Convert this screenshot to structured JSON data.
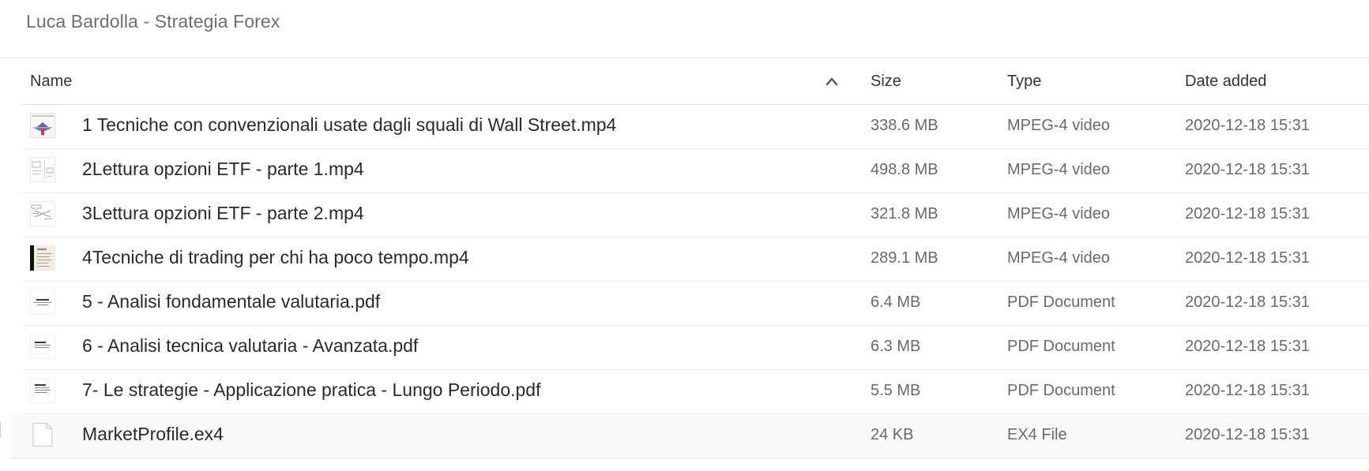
{
  "breadcrumb": "Luca Bardolla - Strategia Forex",
  "columns": {
    "name": "Name",
    "size": "Size",
    "type": "Type",
    "date": "Date added"
  },
  "files": [
    {
      "name": "1 Tecniche con convenzionali usate dagli squali di Wall Street.mp4",
      "size": "338.6 MB",
      "type": "MPEG-4 video",
      "date": "2020-12-18 15:31",
      "thumb": "video-thumb-chart"
    },
    {
      "name": "2Lettura opzioni ETF - parte 1.mp4",
      "size": "498.8 MB",
      "type": "MPEG-4 video",
      "date": "2020-12-18 15:31",
      "thumb": "video-thumb-doc"
    },
    {
      "name": "3Lettura opzioni ETF - parte 2.mp4",
      "size": "321.8 MB",
      "type": "MPEG-4 video",
      "date": "2020-12-18 15:31",
      "thumb": "video-thumb-diagram"
    },
    {
      "name": "4Tecniche di trading per chi ha poco tempo.mp4",
      "size": "289.1 MB",
      "type": "MPEG-4 video",
      "date": "2020-12-18 15:31",
      "thumb": "video-thumb-slide"
    },
    {
      "name": "5 - Analisi fondamentale valutaria.pdf",
      "size": "6.4 MB",
      "type": "PDF Document",
      "date": "2020-12-18 15:31",
      "thumb": "pdf-thumb"
    },
    {
      "name": "6 - Analisi tecnica valutaria - Avanzata.pdf",
      "size": "6.3 MB",
      "type": "PDF Document",
      "date": "2020-12-18 15:31",
      "thumb": "pdf-thumb"
    },
    {
      "name": "7- Le strategie - Applicazione pratica - Lungo Periodo.pdf",
      "size": "5.5 MB",
      "type": "PDF Document",
      "date": "2020-12-18 15:31",
      "thumb": "pdf-thumb"
    },
    {
      "name": "MarketProfile.ex4",
      "size": "24 KB",
      "type": "EX4 File",
      "date": "2020-12-18 15:31",
      "thumb": "generic-file-icon"
    }
  ]
}
